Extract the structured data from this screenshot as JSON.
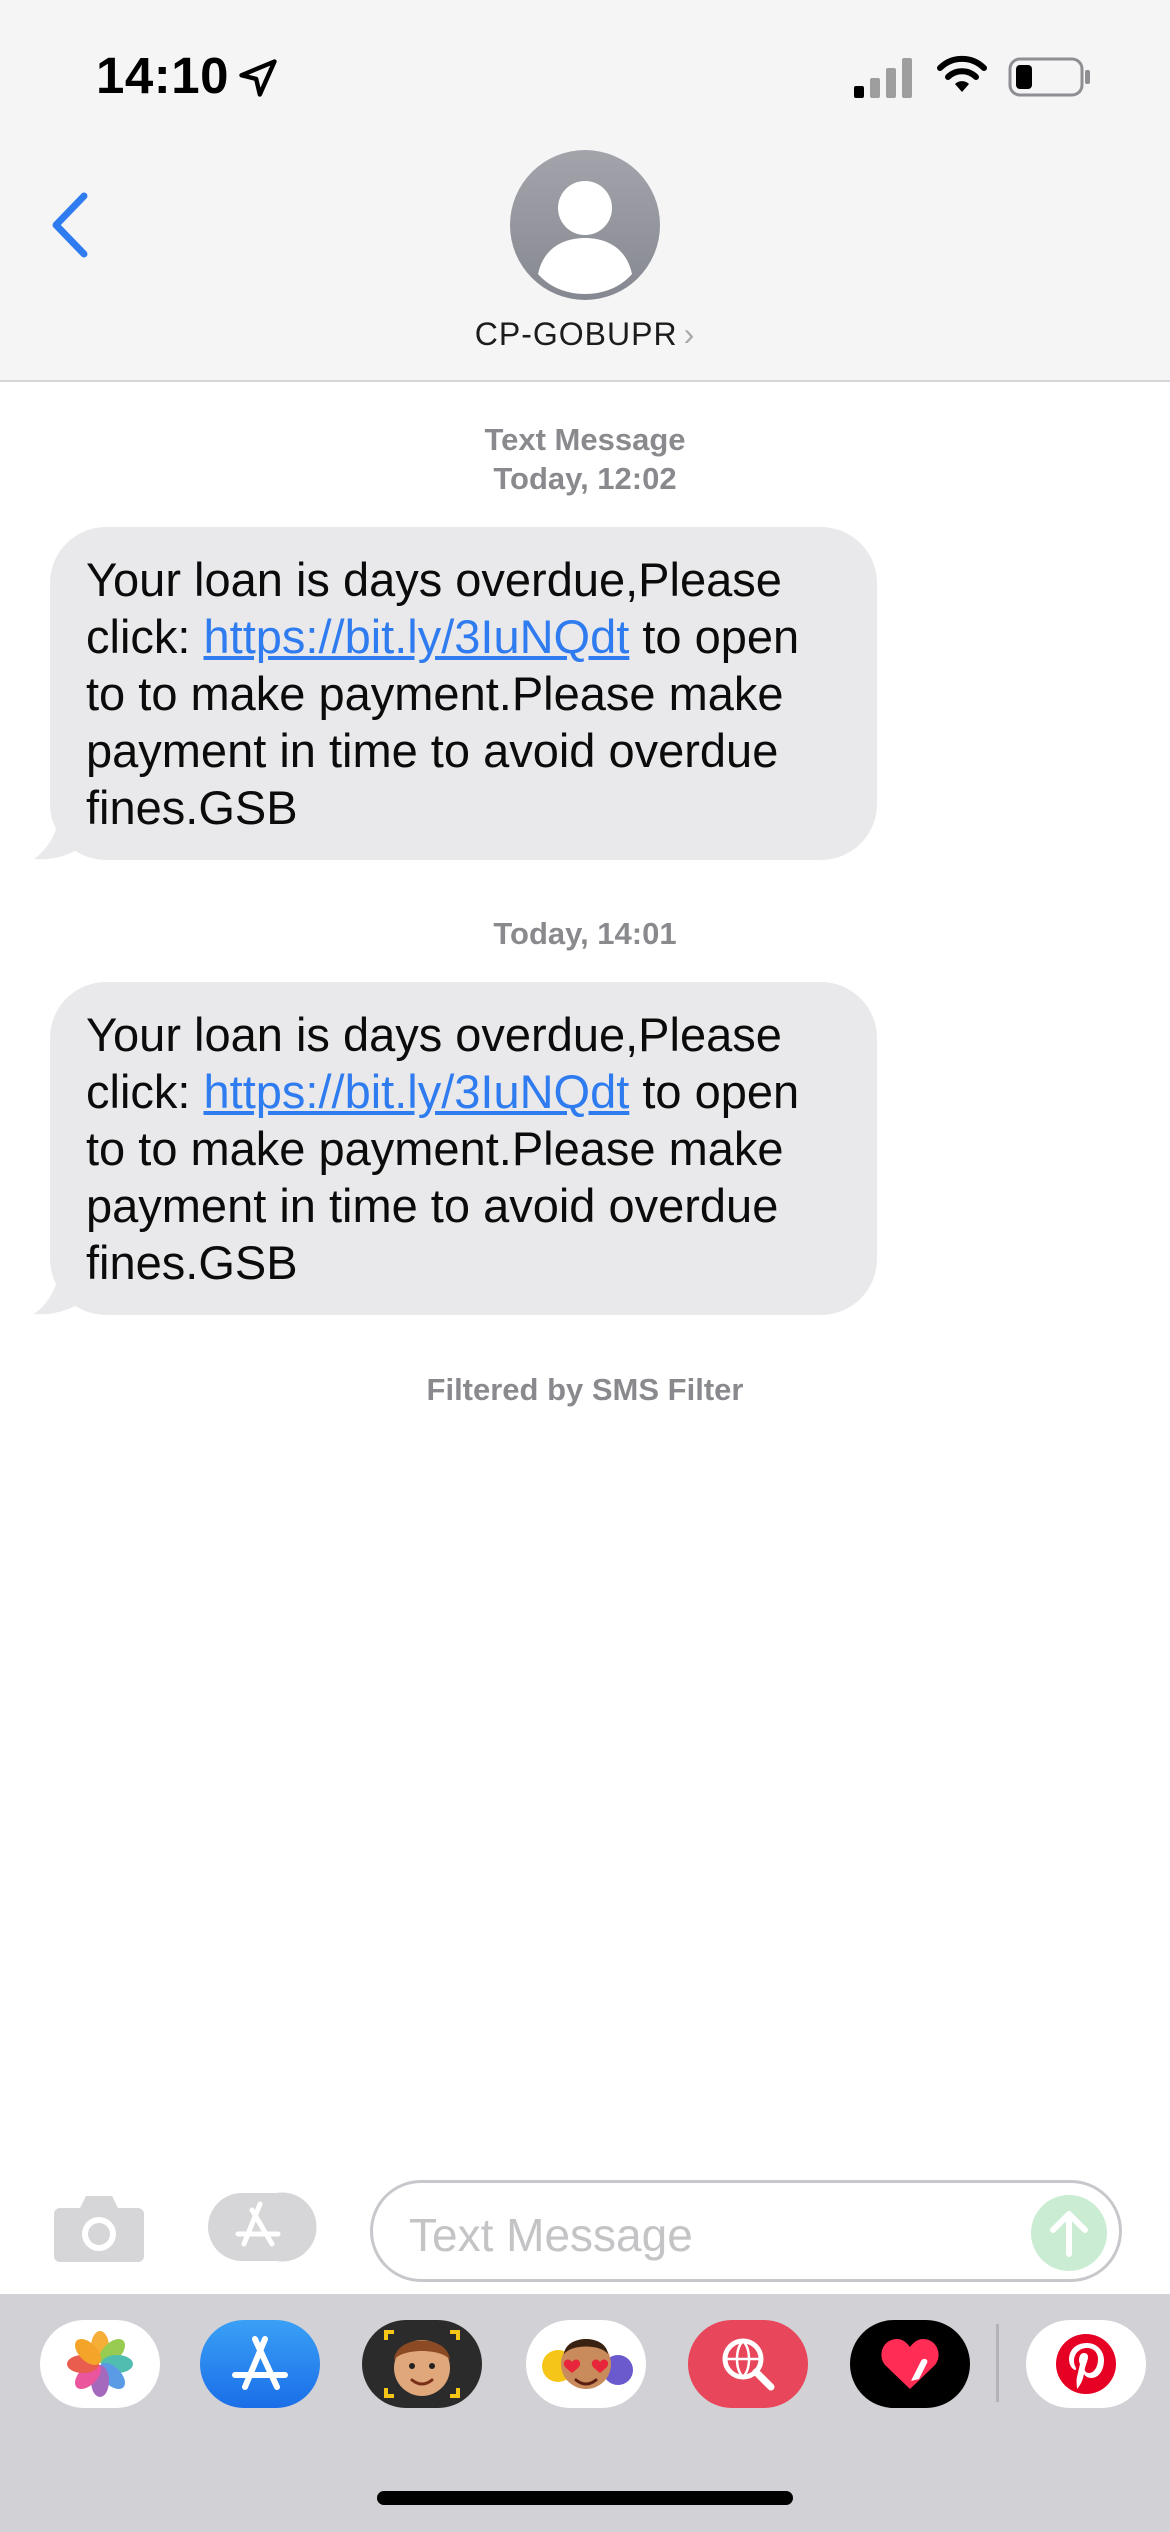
{
  "status_bar": {
    "time": "14:10",
    "icons": [
      "location-arrow-icon",
      "cellular-signal-icon",
      "wifi-icon",
      "battery-icon"
    ]
  },
  "header": {
    "back_icon": "chevron-left-icon",
    "contact_name": "CP-GOBUPR",
    "contact_chevron": "›"
  },
  "messages": {
    "service_label": "Text Message",
    "groups": [
      {
        "timestamp": "Today, 12:02",
        "text_before": "Your loan is days overdue,Please click: ",
        "link": "https://bit.ly/3IuNQdt",
        "text_after": " to open to  to make payment.Please make payment in time to avoid overdue fines.GSB"
      },
      {
        "timestamp": "Today, 14:01",
        "text_before": "Your loan is days overdue,Please click: ",
        "link": "https://bit.ly/3IuNQdt",
        "text_after": " to open to  to make payment.Please make payment in time to avoid overdue fines.GSB"
      }
    ],
    "filter_note": "Filtered by SMS Filter"
  },
  "composer": {
    "placeholder": "Text Message",
    "camera_icon": "camera-icon",
    "apps_icon": "app-store-icon",
    "send_icon": "send-arrow-icon"
  },
  "app_drawer": {
    "apps": [
      "photos-icon",
      "app-store-icon",
      "memoji-icon",
      "animoji-stickers-icon",
      "web-search-icon",
      "digital-touch-icon",
      "pinterest-icon"
    ]
  },
  "colors": {
    "accent": "#2f7bf0",
    "bubble": "#e9e9eb",
    "header_bg": "#f5f5f5",
    "drawer_bg": "#d1d1d6"
  }
}
